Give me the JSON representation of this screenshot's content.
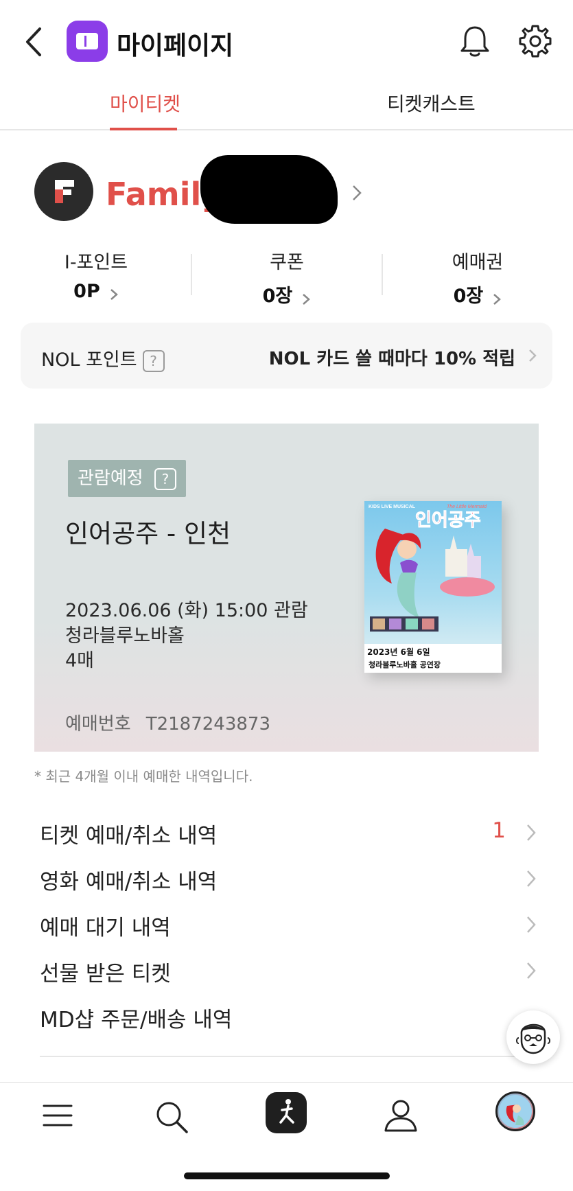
{
  "header": {
    "title": "마이페이지"
  },
  "tabs": [
    {
      "label": "마이티켓",
      "active": true
    },
    {
      "label": "티켓캐스트",
      "active": false
    }
  ],
  "profile": {
    "grade": "Family"
  },
  "stats": [
    {
      "label": "I-포인트",
      "value": "0P"
    },
    {
      "label": "쿠폰",
      "value": "0장"
    },
    {
      "label": "예매권",
      "value": "0장"
    }
  ],
  "nol": {
    "label": "NOL 포인트",
    "help": "?",
    "promo": "NOL 카드 쓸 때마다 10% 적립"
  },
  "ticket": {
    "status": "관람예정",
    "status_help": "?",
    "title": "인어공주 - 인천",
    "datetime": "2023.06.06 (화)  15:00 관람",
    "venue": "청라블루노바홀",
    "quantity": "4매",
    "booking_label": "예매번호",
    "booking_number": "T2187243873",
    "poster": {
      "kicker": "KIDS LIVE MUSICAL",
      "subtitle": "The Little Mermaid",
      "title": "인어공주",
      "date": "2023년 6월 6일",
      "venue": "청라블루노바홀 공연장"
    }
  },
  "notice": "* 최근 4개월 이내 예매한 내역입니다.",
  "menu": [
    {
      "label": "티켓 예매/취소 내역",
      "count": "1"
    },
    {
      "label": "영화 예매/취소 내역",
      "count": ""
    },
    {
      "label": "예매 대기 내역",
      "count": ""
    },
    {
      "label": "선물 받은 티켓",
      "count": ""
    },
    {
      "label": "MD샵 주문/배송 내역",
      "count": ""
    }
  ],
  "icons": {
    "back": "chevron-left-icon",
    "bell": "bell-icon",
    "settings": "gear-icon",
    "menu": "hamburger-icon",
    "search": "search-icon",
    "home": "ticket-person-icon",
    "mypage": "person-icon",
    "chatbot": "chatbot-face-icon"
  },
  "colors": {
    "accent": "#e0504a",
    "brand_purple": "#8b3de8",
    "badge": "#9fb4af"
  }
}
